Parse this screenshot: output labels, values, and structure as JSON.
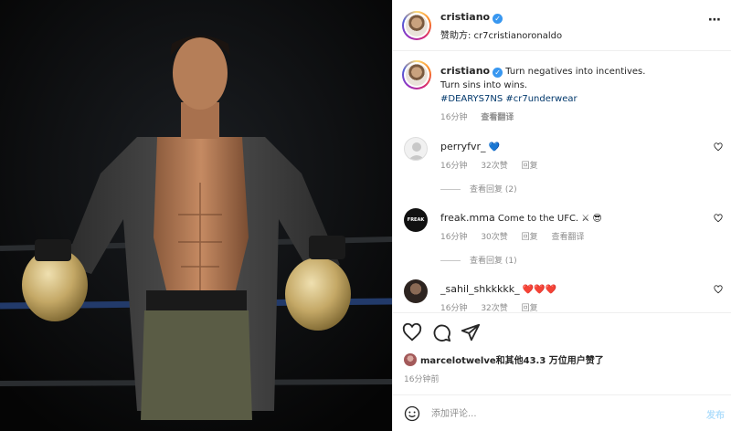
{
  "post": {
    "author": "cristiano",
    "sponsor_label": "赞助方: cr7cristianoronaldo",
    "caption_line1": "Turn negatives into incentives.",
    "caption_line2": "Turn sins into wins.",
    "hashtags": "#DEARYS7NS #cr7underwear",
    "caption_time": "16分钟",
    "see_translation": "查看翻译"
  },
  "comments": [
    {
      "username": "perryfvr_",
      "text": "💙",
      "time": "16分钟",
      "likes": "32次赞",
      "reply": "回复",
      "view_replies": "查看回复 (2)"
    },
    {
      "username": "freak.mma",
      "text": "Come to the UFC. ⚔ 😎",
      "time": "16分钟",
      "likes": "30次赞",
      "reply": "回复",
      "see_translation": "查看翻译",
      "view_replies": "查看回复 (1)",
      "avatar_text": "FREAK"
    },
    {
      "username": "_sahil_shkkkkk_",
      "text": "❤️❤️❤️",
      "time": "16分钟",
      "likes": "32次赞",
      "reply": "回复"
    }
  ],
  "likes_summary": "marcelotwelve和其他43.3 万位用户赞了",
  "post_time": "16分钟前",
  "comment_box": {
    "placeholder": "添加评论...",
    "post_button": "发布"
  },
  "icons": {
    "header_more": "more-horizontal-icon",
    "like": "heart-icon",
    "comment": "comment-icon",
    "share": "send-icon",
    "emoji": "emoji-icon",
    "verified": "verified-badge-icon"
  },
  "colors": {
    "accent": "#3897f0",
    "hashtag": "#00376b",
    "muted": "#8e8e8e"
  }
}
